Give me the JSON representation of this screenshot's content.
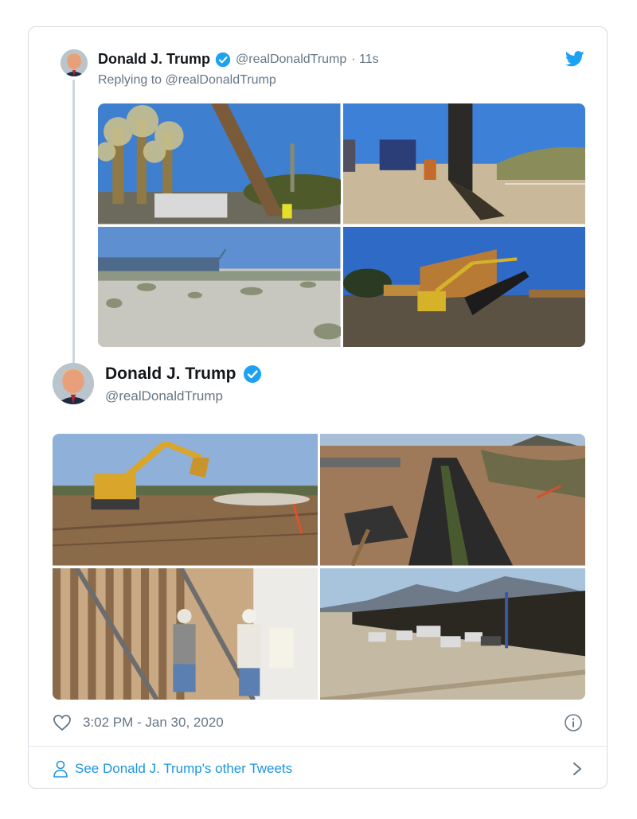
{
  "reply_tweet": {
    "author_name": "Donald J. Trump",
    "handle": "@realDonaldTrump",
    "time_ago": "· 11s",
    "replying_prefix": "Replying to",
    "replying_to": "@realDonaldTrump",
    "photos": [
      {
        "alt": "photo-cactus-crane"
      },
      {
        "alt": "photo-wall-trucks"
      },
      {
        "alt": "photo-desert-fence"
      },
      {
        "alt": "photo-excavator-wall-panel"
      }
    ]
  },
  "main_tweet": {
    "author_name": "Donald J. Trump",
    "handle": "@realDonaldTrump",
    "photos": [
      {
        "alt": "photo-excavator-field"
      },
      {
        "alt": "photo-trench-tarps"
      },
      {
        "alt": "photo-workers-wall"
      },
      {
        "alt": "photo-wall-mountains"
      }
    ],
    "timestamp": "3:02 PM - Jan 30, 2020"
  },
  "footer": {
    "see_more": "See Donald J. Trump's other Tweets"
  },
  "icons": {
    "verified": "verified-badge-icon",
    "twitter": "twitter-bird-icon",
    "heart": "heart-icon",
    "info": "info-icon",
    "person": "person-icon",
    "chevron": "chevron-right-icon"
  },
  "colors": {
    "twitter_blue": "#1da1f2",
    "link_blue": "#1b95e0",
    "gray_text": "#657786",
    "border": "#d6dde3"
  }
}
